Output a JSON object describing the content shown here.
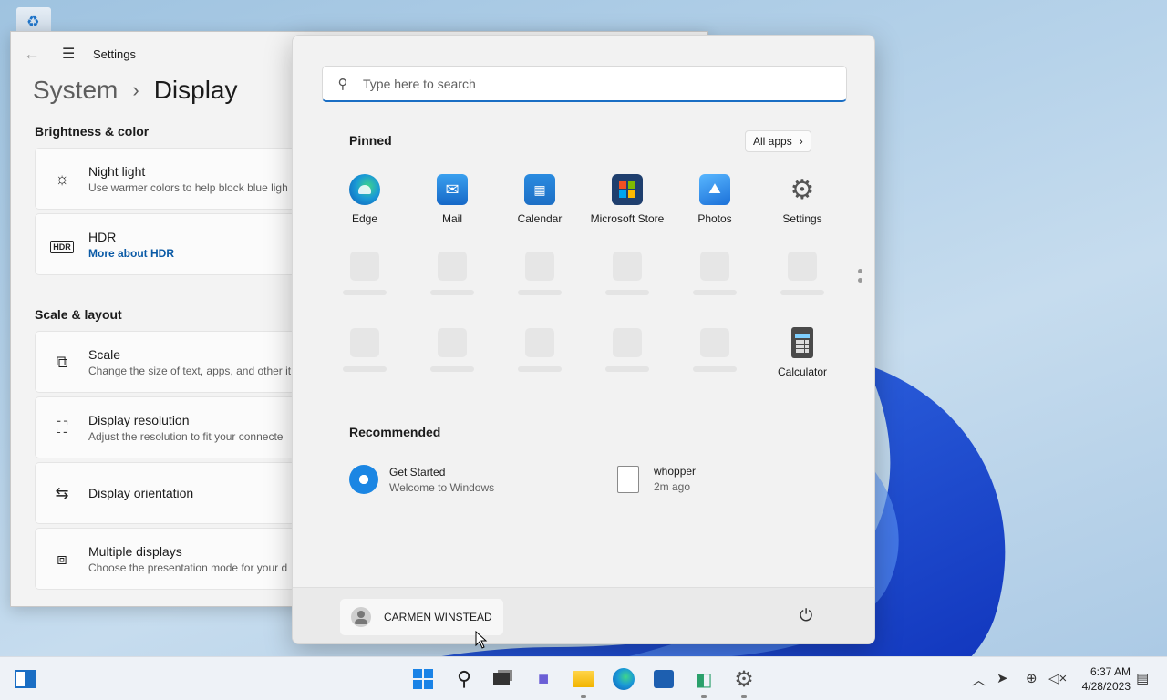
{
  "settings": {
    "title": "Settings",
    "breadcrumb": {
      "parent": "System",
      "current": "Display"
    },
    "sections": {
      "brightness": "Brightness & color",
      "scale": "Scale & layout"
    },
    "cards": {
      "night_light": {
        "title": "Night light",
        "desc": "Use warmer colors to help block blue ligh"
      },
      "hdr": {
        "title": "HDR",
        "link": "More about HDR"
      },
      "scale": {
        "title": "Scale",
        "desc": "Change the size of text, apps, and other it"
      },
      "resolution": {
        "title": "Display resolution",
        "desc": "Adjust the resolution to fit your connecte"
      },
      "orientation": {
        "title": "Display orientation"
      },
      "multiple": {
        "title": "Multiple displays",
        "desc": "Choose the presentation mode for your d"
      }
    }
  },
  "start": {
    "search_placeholder": "Type here to search",
    "pinned_label": "Pinned",
    "all_apps_label": "All apps",
    "apps": [
      "Edge",
      "Mail",
      "Calendar",
      "Microsoft Store",
      "Photos",
      "Settings",
      "Calculator"
    ],
    "recommended_label": "Recommended",
    "recommended": [
      {
        "name": "Get Started",
        "detail": "Welcome to Windows"
      },
      {
        "name": "whopper",
        "detail": "2m ago"
      }
    ],
    "user_name": "CARMEN WINSTEAD"
  },
  "taskbar": {
    "time": "6:37 AM",
    "date": "4/28/2023",
    "pinned": [
      "start-icon",
      "search-icon",
      "task-view-icon",
      "chat-icon",
      "file-explorer-icon",
      "edge-icon",
      "store-icon",
      "app-icon",
      "settings-icon"
    ]
  },
  "colors": {
    "accent": "#1a6ec4",
    "link": "#0a5aa6",
    "wallpaper_bloom": "#1f4fd6"
  }
}
